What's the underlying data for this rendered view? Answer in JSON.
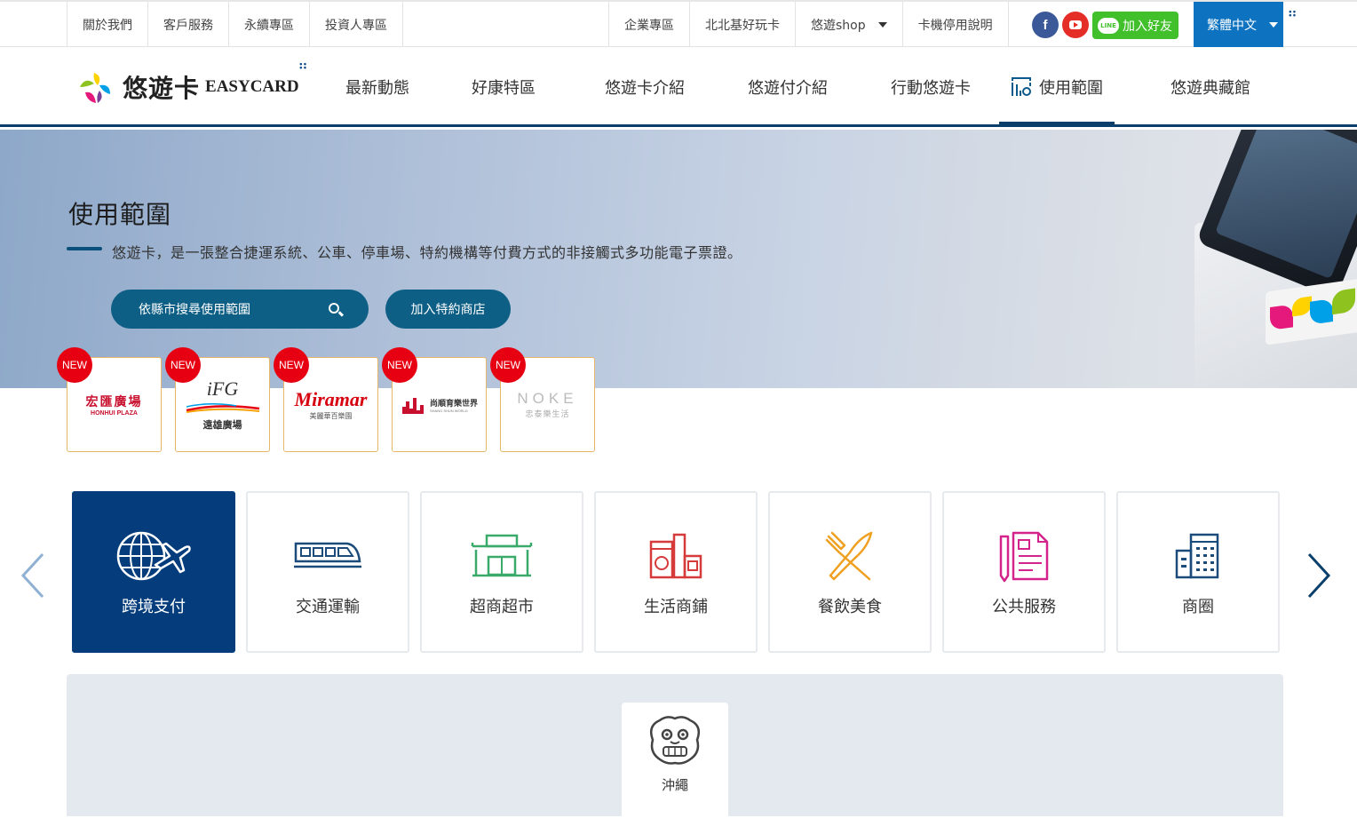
{
  "topbar": {
    "left_links": [
      "關於我們",
      "客戶服務",
      "永續專區",
      "投資人專區"
    ],
    "right_links": [
      "企業專區",
      "北北基好玩卡",
      "悠遊shop",
      "卡機停用說明"
    ],
    "line_label": "加入好友",
    "line_badge": "LINE",
    "facebook_glyph": "f",
    "language": "繁體中文"
  },
  "header": {
    "logo_zh": "悠遊卡",
    "logo_en": "EASYCARD",
    "nav": [
      "最新動態",
      "好康特區",
      "悠遊卡介紹",
      "悠遊付介紹",
      "行動悠遊卡",
      "使用範圍",
      "悠遊典藏館"
    ],
    "active_nav": "使用範圍"
  },
  "hero": {
    "title": "使用範圍",
    "description": "悠遊卡，是一張整合捷運系統、公車、停車場、特約機構等付費方式的非接觸式多功能電子票證。",
    "search_button": "依縣市搜尋使用範圍",
    "join_button": "加入特約商店"
  },
  "merchants": [
    {
      "badge": "NEW",
      "name": "宏匯廣場",
      "sub": "HONHUI PLAZA"
    },
    {
      "badge": "NEW",
      "name": "iFG",
      "sub": "遠雄廣場"
    },
    {
      "badge": "NEW",
      "name": "Miramar",
      "sub": "美麗華百樂園"
    },
    {
      "badge": "NEW",
      "name": "尚順育樂世界",
      "sub": "SHANG SHUN WORLD"
    },
    {
      "badge": "NEW",
      "name": "NOKE",
      "sub": "忠泰樂生活"
    }
  ],
  "categories": [
    {
      "label": "跨境支付",
      "icon": "globe-plane-icon",
      "active": true
    },
    {
      "label": "交通運輸",
      "icon": "train-icon",
      "active": false
    },
    {
      "label": "超商超市",
      "icon": "store-icon",
      "active": false
    },
    {
      "label": "生活商鋪",
      "icon": "appliances-icon",
      "active": false
    },
    {
      "label": "餐飲美食",
      "icon": "fork-knife-icon",
      "active": false
    },
    {
      "label": "公共服務",
      "icon": "document-icon",
      "active": false
    },
    {
      "label": "商圈",
      "icon": "building-icon",
      "active": false
    }
  ],
  "region": {
    "label": "沖繩",
    "icon": "shisa-lion-icon"
  },
  "colors": {
    "primary": "#053d7c",
    "button": "#0e5f86",
    "language": "#0d73c0",
    "line": "#41c02b",
    "new_badge": "#e60012"
  }
}
